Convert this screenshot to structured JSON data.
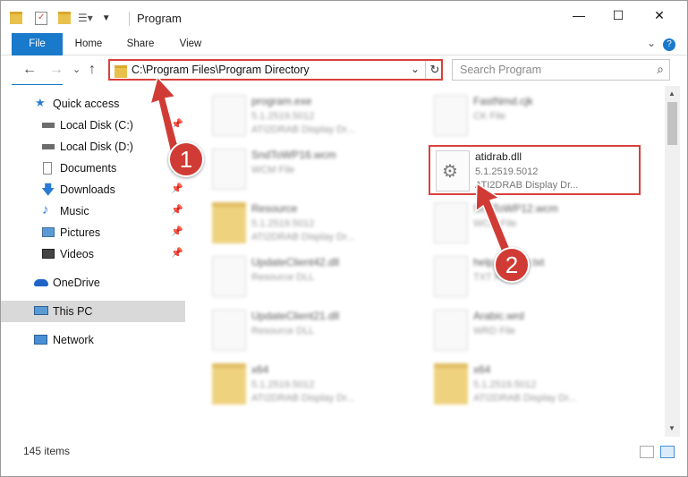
{
  "window": {
    "title": "Program"
  },
  "window_controls": {
    "minimize": "—",
    "maximize": "☐",
    "close": "✕"
  },
  "ribbon": {
    "tabs": [
      "File",
      "Home",
      "Share",
      "View"
    ],
    "expand": "⌄",
    "help": "?"
  },
  "nav": {
    "back": "←",
    "forward": "→",
    "recent": "⌄",
    "up": "↑",
    "address": "C:\\Program Files\\Program Directory",
    "address_drop": "⌄",
    "refresh": "↻",
    "search_placeholder": "Search Program",
    "search_icon": "⌕"
  },
  "sidebar": {
    "items": [
      {
        "label": "Quick access",
        "icon": "star-icon",
        "pinned": false
      },
      {
        "label": "Local Disk (C:)",
        "icon": "drive-icon",
        "pinned": true
      },
      {
        "label": "Local Disk (D:)",
        "icon": "drive-icon",
        "pinned": false
      },
      {
        "label": "Documents",
        "icon": "documents-icon",
        "pinned": true
      },
      {
        "label": "Downloads",
        "icon": "download-arrow-icon",
        "pinned": true
      },
      {
        "label": "Music",
        "icon": "music-note-icon",
        "pinned": true
      },
      {
        "label": "Pictures",
        "icon": "pictures-icon",
        "pinned": true
      },
      {
        "label": "Videos",
        "icon": "videos-icon",
        "pinned": true
      },
      {
        "label": "OneDrive",
        "icon": "cloud-icon",
        "pinned": false
      },
      {
        "label": "This PC",
        "icon": "computer-icon",
        "pinned": false
      },
      {
        "label": "Network",
        "icon": "network-icon",
        "pinned": false
      }
    ],
    "pin_glyph": "📌"
  },
  "files": [
    {
      "name": "program.exe",
      "l2": "5.1.2519.5012",
      "l3": "ATI2DRAB Display Dr...",
      "type": "exe",
      "blurred": true
    },
    {
      "name": "FastNmd.cjk",
      "l2": "CK File",
      "l3": "",
      "type": "doc",
      "blurred": true
    },
    {
      "name": "SndToWP16.wcm",
      "l2": "WCM File",
      "l3": "",
      "type": "doc",
      "blurred": true
    },
    {
      "name": "atidrab.dll",
      "l2": "5.1.2519.5012",
      "l3": "ATI2DRAB Display Dr...",
      "type": "dll",
      "blurred": false
    },
    {
      "name": "Resource",
      "l2": "5.1.2519.5012",
      "l3": "ATI2DRAB Display Dr...",
      "type": "folder",
      "blurred": true
    },
    {
      "name": "SndToWP12.wcm",
      "l2": "WCM File",
      "l3": "",
      "type": "doc",
      "blurred": true
    },
    {
      "name": "UpdateClient42.dll",
      "l2": "Resource DLL",
      "l3": "",
      "type": "dll",
      "blurred": true
    },
    {
      "name": "help_reader.txt",
      "l2": "TXT File",
      "l3": "",
      "type": "doc",
      "blurred": true
    },
    {
      "name": "UpdateClient21.dll",
      "l2": "Resource DLL",
      "l3": "",
      "type": "dll",
      "blurred": true
    },
    {
      "name": "Arabic.wrd",
      "l2": "WRD File",
      "l3": "",
      "type": "doc",
      "blurred": true
    },
    {
      "name": "x64",
      "l2": "5.1.2519.5012",
      "l3": "ATI2DRAB Display Dr...",
      "type": "folder",
      "blurred": true
    },
    {
      "name": "x64",
      "l2": "5.1.2519.5012",
      "l3": "ATI2DRAB Display Dr...",
      "type": "folder",
      "blurred": true
    }
  ],
  "status": {
    "count": "145 items"
  },
  "annotations": {
    "step1": "1",
    "step2": "2",
    "color": "#d03c35"
  }
}
